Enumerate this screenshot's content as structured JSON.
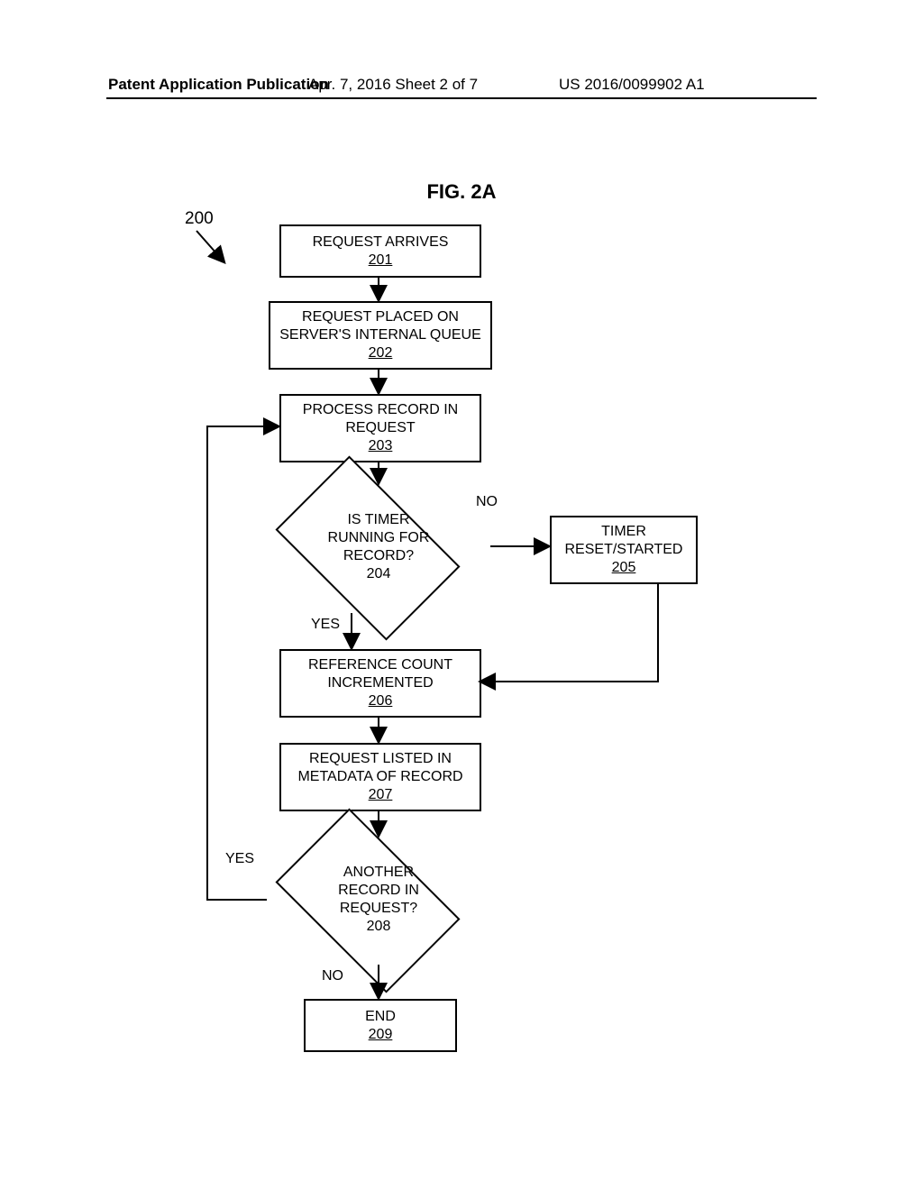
{
  "header": {
    "left": "Patent Application Publication",
    "mid": "Apr. 7, 2016  Sheet 2 of 7",
    "right": "US 2016/0099902 A1"
  },
  "figure_label": "FIG. 2A",
  "ref_number": "200",
  "steps": {
    "s201": {
      "text": "REQUEST ARRIVES",
      "num": "201"
    },
    "s202": {
      "text_l1": "REQUEST PLACED ON",
      "text_l2": "SERVER'S INTERNAL QUEUE",
      "num": "202"
    },
    "s203": {
      "text_l1": "PROCESS RECORD IN",
      "text_l2": "REQUEST",
      "num": "203"
    },
    "s204": {
      "text_l1": "IS TIMER",
      "text_l2": "RUNNING FOR",
      "text_l3": "RECORD?",
      "num": "204"
    },
    "s205": {
      "text_l1": "TIMER",
      "text_l2": "RESET/STARTED",
      "num": "205"
    },
    "s206": {
      "text_l1": "REFERENCE COUNT",
      "text_l2": "INCREMENTED",
      "num": "206"
    },
    "s207": {
      "text_l1": "REQUEST LISTED IN",
      "text_l2": "METADATA OF RECORD",
      "num": "207"
    },
    "s208": {
      "text_l1": "ANOTHER",
      "text_l2": "RECORD IN",
      "text_l3": "REQUEST?",
      "num": "208"
    },
    "s209": {
      "text": "END",
      "num": "209"
    }
  },
  "labels": {
    "no1": "NO",
    "yes1": "YES",
    "yes2": "YES",
    "no2": "NO"
  }
}
